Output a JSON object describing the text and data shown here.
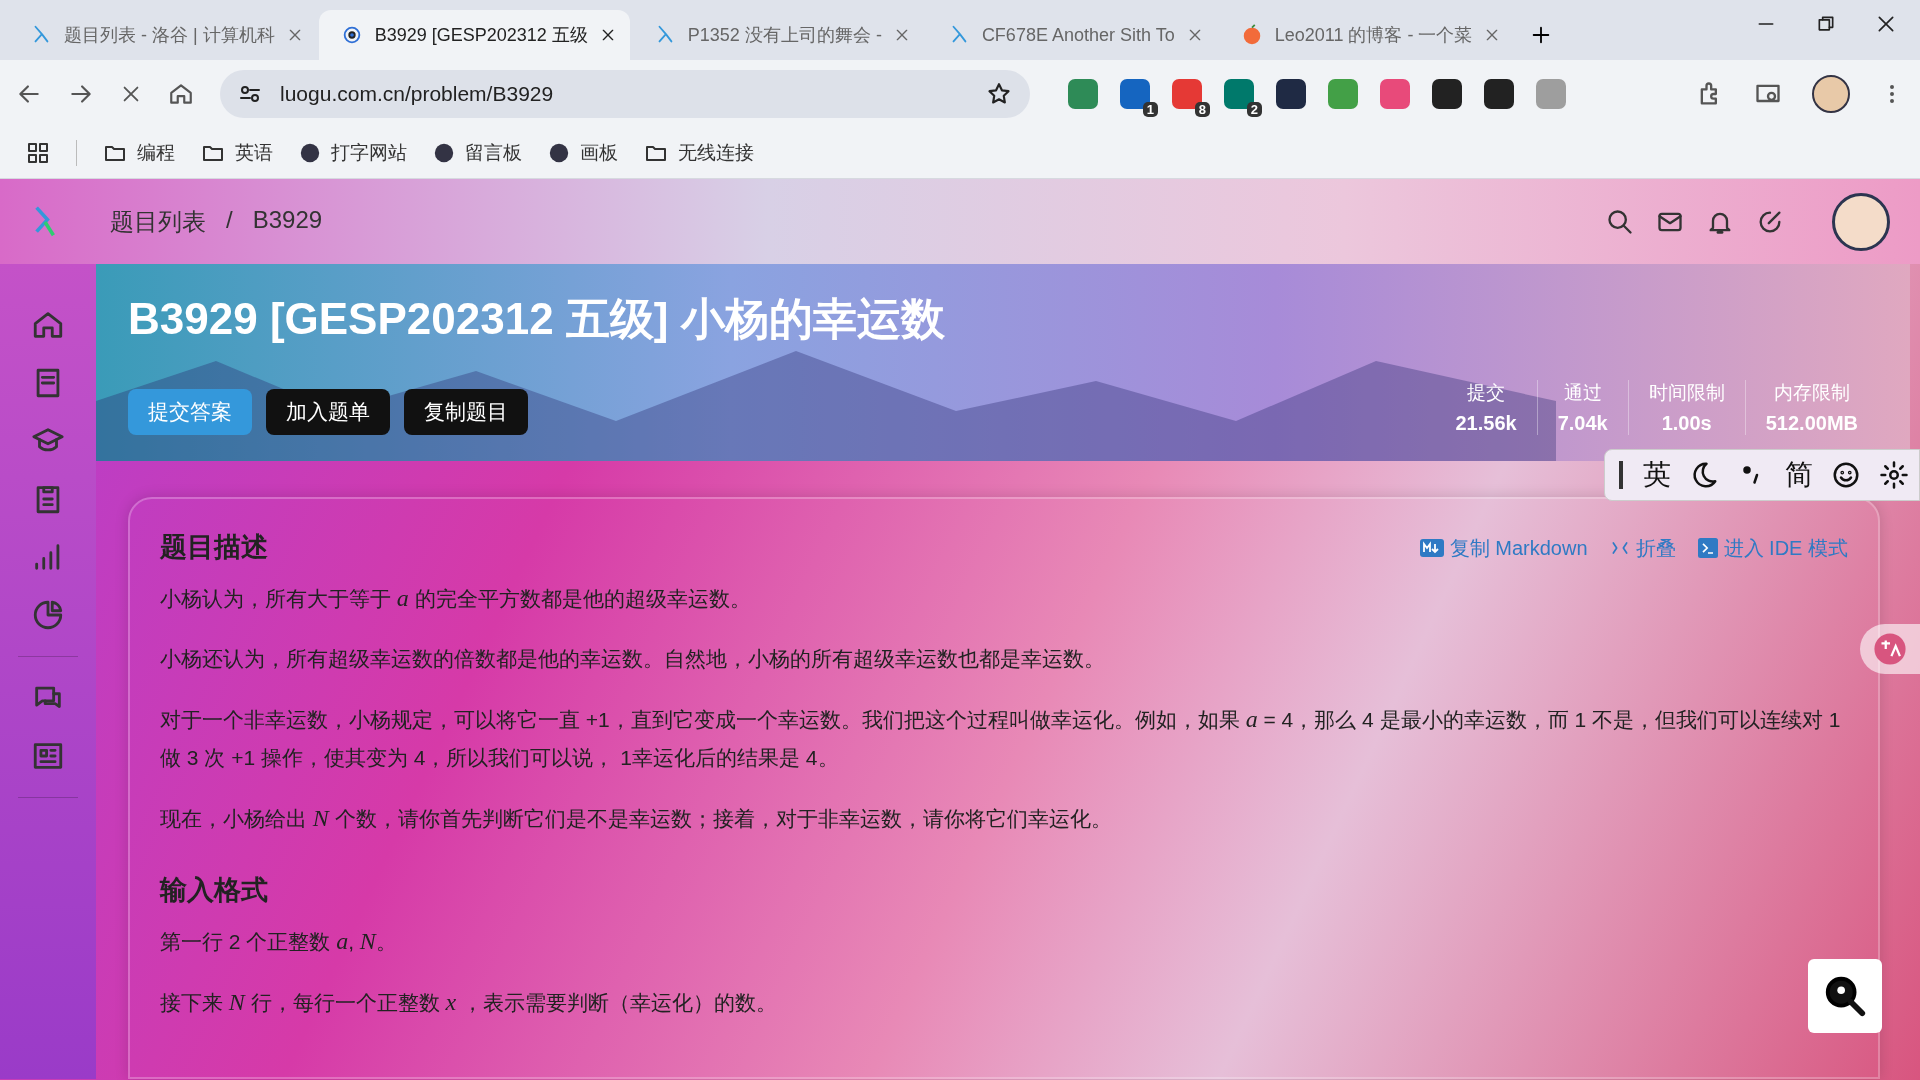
{
  "tabs": [
    {
      "title": "题目列表 - 洛谷 | 计算机科",
      "selected": false,
      "kind": "luogu"
    },
    {
      "title": "B3929 [GESP202312 五级",
      "selected": true,
      "kind": "loading"
    },
    {
      "title": "P1352 没有上司的舞会 - ",
      "selected": false,
      "kind": "luogu"
    },
    {
      "title": "CF678E Another Sith To",
      "selected": false,
      "kind": "luogu"
    },
    {
      "title": "Leo2011 的博客 - 一个菜",
      "selected": false,
      "kind": "peach"
    }
  ],
  "address": "luogu.com.cn/problem/B3929",
  "extensions": [
    {
      "color": "#2e8b57"
    },
    {
      "color": "#1565c0",
      "badge": "1"
    },
    {
      "color": "#e53935",
      "badge": "8"
    },
    {
      "color": "#00796b",
      "badge": "2"
    },
    {
      "color": "#1f2a44"
    },
    {
      "color": "#43a047"
    },
    {
      "color": "#e84a7a"
    },
    {
      "color": "#222222"
    },
    {
      "color": "#222222"
    },
    {
      "color": "#9e9e9e"
    }
  ],
  "bookmarks": [
    {
      "label": "编程",
      "kind": "folder"
    },
    {
      "label": "英语",
      "kind": "folder"
    },
    {
      "label": "打字网站",
      "kind": "site"
    },
    {
      "label": "留言板",
      "kind": "site"
    },
    {
      "label": "画板",
      "kind": "site"
    },
    {
      "label": "无线连接",
      "kind": "folder"
    }
  ],
  "breadcrumb": {
    "items": [
      "题目列表",
      "B3929"
    ],
    "separator": "/"
  },
  "banner": {
    "title": "B3929 [GESP202312 五级] 小杨的幸运数",
    "buttons": [
      {
        "label": "提交答案",
        "kind": "primary"
      },
      {
        "label": "加入题单",
        "kind": "dark"
      },
      {
        "label": "复制题目",
        "kind": "dark"
      }
    ],
    "stats": [
      {
        "label": "提交",
        "value": "21.56k"
      },
      {
        "label": "通过",
        "value": "7.04k"
      },
      {
        "label": "时间限制",
        "value": "1.00s"
      },
      {
        "label": "内存限制",
        "value": "512.00MB"
      }
    ]
  },
  "ime": {
    "language": "英",
    "script": "简"
  },
  "actions": [
    {
      "label": "复制 Markdown",
      "kind": "markdown"
    },
    {
      "label": "折叠",
      "kind": "fold"
    },
    {
      "label": "进入 IDE 模式",
      "kind": "ide"
    }
  ],
  "sections": [
    {
      "heading": "题目描述",
      "paragraphs": [
        "小杨认为，所有大于等于 *a* 的完全平方数都是他的超级幸运数。",
        "小杨还认为，所有超级幸运数的倍数都是他的幸运数。自然地，小杨的所有超级幸运数也都是幸运数。",
        "对于一个非幸运数，小杨规定，可以将它一直 +1，直到它变成一个幸运数。我们把这个过程叫做幸运化。例如，如果 *a* = 4，那么 4 是最小的幸运数，而 1 不是，但我们可以连续对 1 做 3 次 +1 操作，使其变为 4，所以我们可以说， 1幸运化后的结果是 4。",
        "现在，小杨给出 *N* 个数，请你首先判断它们是不是幸运数；接着，对于非幸运数，请你将它们幸运化。"
      ]
    },
    {
      "heading": "输入格式",
      "paragraphs": [
        "第一行 2 个正整数 *a*, *N*。",
        "接下来 *N* 行，每行一个正整数 *x* ，表示需要判断（幸运化）的数。"
      ]
    }
  ]
}
